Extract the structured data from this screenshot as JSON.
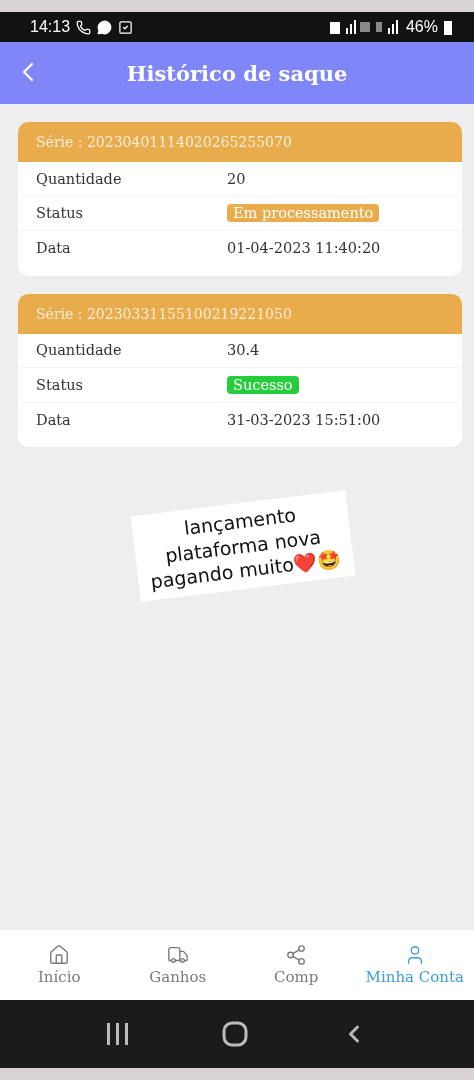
{
  "status_bar": {
    "time": "14:13",
    "battery": "46%"
  },
  "header": {
    "title": "Histórico de saque"
  },
  "records": [
    {
      "serial": "Série : 20230401114020265255070",
      "rows": [
        {
          "label": "Quantidade",
          "value": "20",
          "kind": "text"
        },
        {
          "label": "Status",
          "value": "Em processamento",
          "kind": "processing"
        },
        {
          "label": "Data",
          "value": "01-04-2023 11:40:20",
          "kind": "text"
        }
      ]
    },
    {
      "serial": "Série : 20230331155100219221050",
      "rows": [
        {
          "label": "Quantidade",
          "value": "30.4",
          "kind": "text"
        },
        {
          "label": "Status",
          "value": "Sucesso",
          "kind": "success"
        },
        {
          "label": "Data",
          "value": "31-03-2023 15:51:00",
          "kind": "text"
        }
      ]
    }
  ],
  "sticker": {
    "lines": [
      "lançamento",
      "plataforma nova",
      "pagando muito❤️🤩"
    ]
  },
  "bottom_nav": [
    {
      "label": "Início",
      "selected": false
    },
    {
      "label": "Ganhos",
      "selected": false
    },
    {
      "label": "Comp",
      "selected": false
    },
    {
      "label": "Minha Conta",
      "selected": true
    }
  ]
}
